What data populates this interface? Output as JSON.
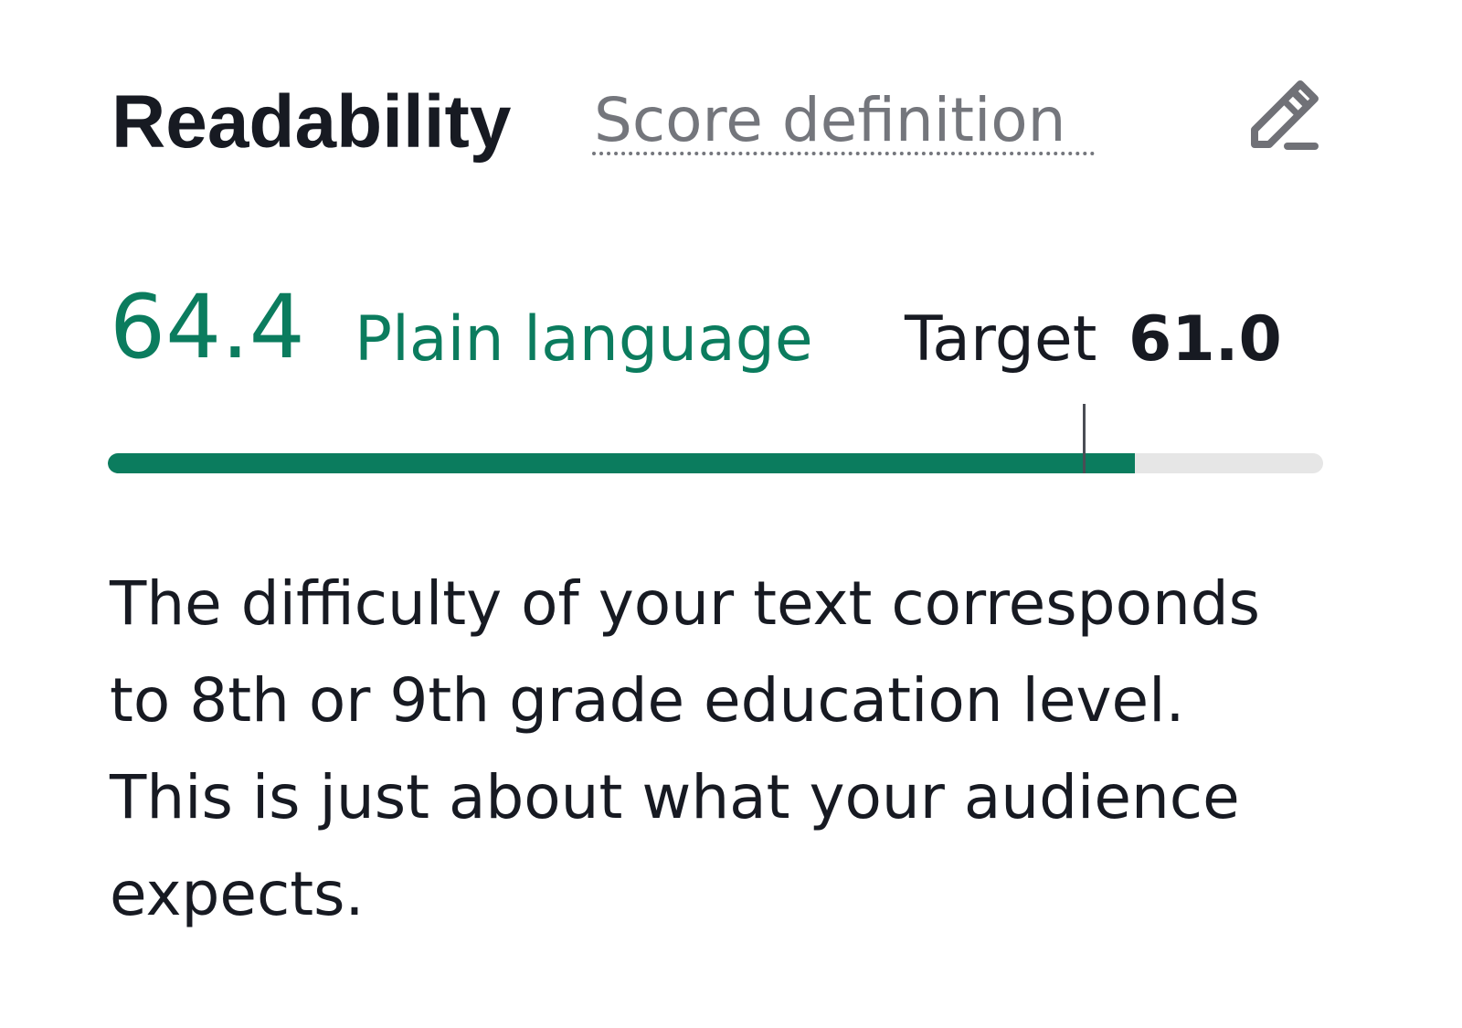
{
  "header": {
    "title": "Readability",
    "score_definition_link": "Score definition",
    "edit_icon": "pencil-edit-icon"
  },
  "score": {
    "value": "64.4",
    "label": "Plain language",
    "target_label": "Target",
    "target_value": "61.0"
  },
  "progress": {
    "fill_fraction": 0.845,
    "target_fraction": 0.802,
    "fill_color": "#0b7c5e",
    "track_color": "#e6e6e6",
    "marker_color": "#4a4d55"
  },
  "description": {
    "text": "The difficulty of your text corresponds to 8th or 9th grade education level. This is just about what your audience expects."
  },
  "colors": {
    "accent": "#0b7c5e",
    "text": "#171a22",
    "muted": "#74767c"
  }
}
